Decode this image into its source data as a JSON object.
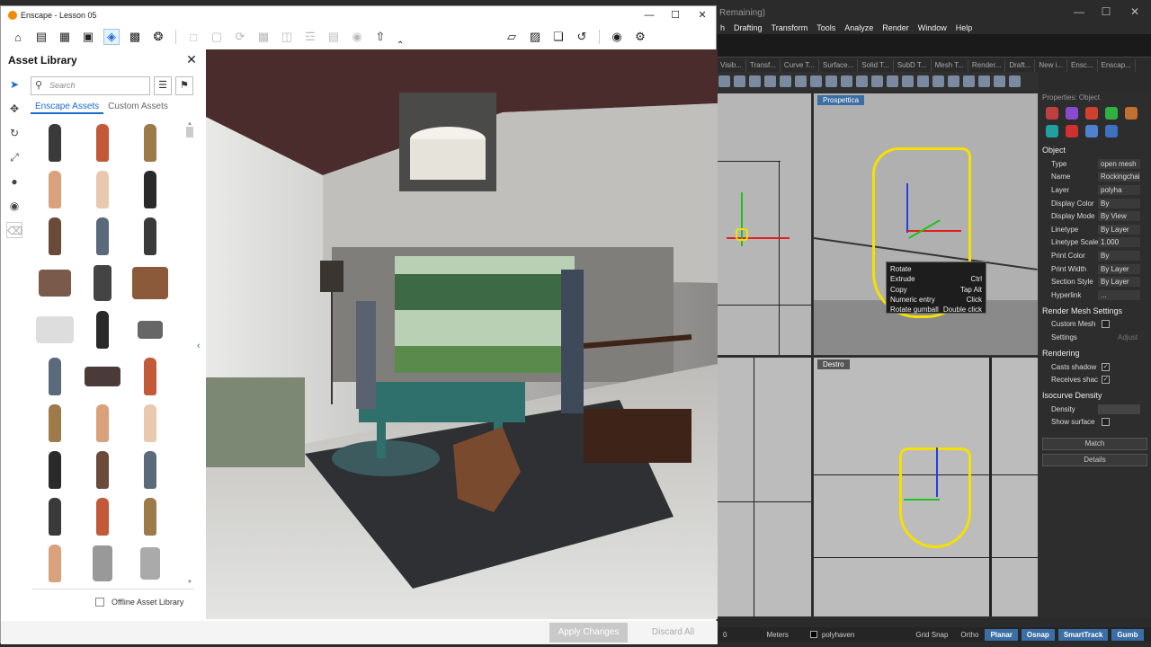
{
  "rhino": {
    "title_suffix": "Remaining)",
    "menu": [
      "h",
      "Drafting",
      "Transform",
      "Tools",
      "Analyze",
      "Render",
      "Window",
      "Help"
    ],
    "toolbar_tabs": [
      "Visib...",
      "Transf...",
      "Curve T...",
      "Surface...",
      "Solid T...",
      "SubD T...",
      "Mesh T...",
      "Render...",
      "Draft...",
      "New i...",
      "Ensc...",
      "Enscap..."
    ],
    "viewports": {
      "perspective": "Prospettica",
      "right": "Destro"
    },
    "context_menu": [
      {
        "label": "Rotate",
        "shortcut": ""
      },
      {
        "label": "Extrude",
        "shortcut": "Ctrl"
      },
      {
        "label": "Copy",
        "shortcut": "Tap Alt"
      },
      {
        "label": "Numeric entry",
        "shortcut": "Click"
      },
      {
        "label": "Rotate gumball",
        "shortcut": "Double click"
      }
    ],
    "properties": {
      "panel_title": "Properties: Object",
      "object_section": "Object",
      "rows": [
        {
          "k": "Type",
          "v": "open mesh"
        },
        {
          "k": "Name",
          "v": "Rockingchai"
        },
        {
          "k": "Layer",
          "v": "polyha"
        },
        {
          "k": "Display Color",
          "v": "By"
        },
        {
          "k": "Display Mode",
          "v": "By View"
        },
        {
          "k": "Linetype",
          "v": "By Layer"
        },
        {
          "k": "Linetype Scale",
          "v": "1.000"
        },
        {
          "k": "Print Color",
          "v": "By"
        },
        {
          "k": "Print Width",
          "v": "By Layer"
        },
        {
          "k": "Section Style",
          "v": "By Layer"
        },
        {
          "k": "Hyperlink",
          "v": "..."
        }
      ],
      "render_mesh_section": "Render Mesh Settings",
      "custom_mesh": "Custom Mesh",
      "settings": "Settings",
      "adjust": "Adjust",
      "rendering_section": "Rendering",
      "casts_shadows": "Casts shadow",
      "receives_shadows": "Receives shac",
      "isocurve_section": "Isocurve Density",
      "density": "Density",
      "show_surface": "Show surface",
      "match_button": "Match",
      "details_button": "Details"
    },
    "status": {
      "zero": "0",
      "units": "Meters",
      "layer": "polyhaven",
      "grid_snap": "Grid Snap",
      "ortho": "Ortho",
      "planar": "Planar",
      "osnap": "Osnap",
      "smarttrack": "SmartTrack",
      "gumball": "Gumb"
    }
  },
  "enscape": {
    "title": "Enscape - Lesson 05",
    "asset_library": {
      "heading": "Asset Library",
      "search_placeholder": "Search",
      "tabs": [
        "Enscape Assets",
        "Custom Assets"
      ],
      "offline_label": "Offline Asset Library"
    },
    "footer": {
      "apply": "Apply Changes",
      "discard": "Discard All"
    },
    "colors": {
      "accent": "#1a6bd1",
      "brand": "#f08a00"
    }
  }
}
